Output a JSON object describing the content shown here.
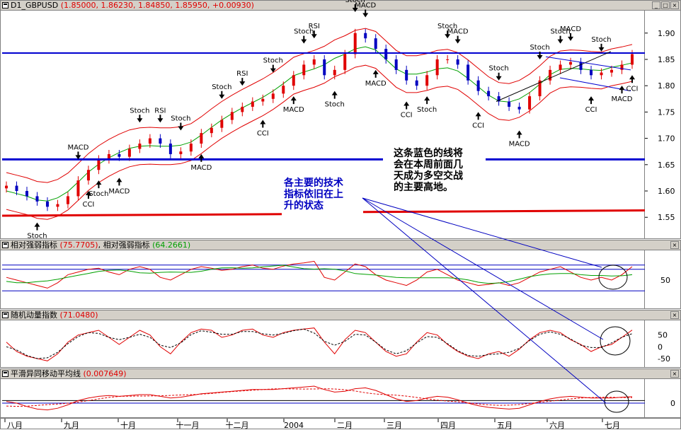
{
  "main": {
    "title_symbol": "D1_GBPUSD",
    "title_values": "(1.85000, 1.86230, 1.84850, 1.85950, +0.00930)",
    "y_ticks": [
      "1.90",
      "1.85",
      "1.80",
      "1.75",
      "1.70",
      "1.65",
      "1.60",
      "1.55"
    ],
    "annotation_right": [
      "这条蓝色的线将",
      "会在本周前面几",
      "天成为多空交战",
      "的主要高地。"
    ],
    "annotation_center": [
      "各主要的技术",
      "指标依旧在上",
      "升的状态"
    ],
    "signal_labels": {
      "stoch": "Stoch",
      "macd": "MACD",
      "cci": "CCI",
      "rsi": "RSI"
    }
  },
  "rsi_panel": {
    "title": "相对强弱指标",
    "value": "(75.7705)",
    "title2": "相对强弱指标",
    "value2": "(64.2661)",
    "y_ticks": [
      "50"
    ]
  },
  "stoch_panel": {
    "title": "随机动量指数",
    "value": "(71.0480)",
    "y_ticks": [
      "50",
      "0",
      "-50"
    ]
  },
  "macd_panel": {
    "title": "平滑异同移动平均线",
    "value": "(0.007649)",
    "y_ticks": [
      "0"
    ]
  },
  "x_axis": [
    "八月",
    "九月",
    "十月",
    "十一月",
    "十二月",
    "2004",
    "二月",
    "三月",
    "四月",
    "五月",
    "六月",
    "七月"
  ],
  "colors": {
    "bull": "#e00000",
    "bear": "#0000c0",
    "band": "#e00000",
    "ma": "#00a000",
    "hline": "#0000d0",
    "support": "#e00000"
  },
  "chart_data": {
    "type": "line",
    "title": "D1_GBPUSD",
    "y_range": [
      1.51,
      1.94
    ],
    "resistance_level": 1.862,
    "support_level": 1.66,
    "ohlc_last": {
      "open": 1.85,
      "high": 1.8623,
      "low": 1.8485,
      "close": 1.8595,
      "change": 0.0093
    },
    "months": [
      "八月",
      "九月",
      "十月",
      "十一月",
      "十二月",
      "2004",
      "二月",
      "三月",
      "四月",
      "五月",
      "六月",
      "七月"
    ],
    "close": [
      1.61,
      1.6,
      1.59,
      1.58,
      1.57,
      1.575,
      1.59,
      1.62,
      1.64,
      1.66,
      1.67,
      1.665,
      1.68,
      1.69,
      1.7,
      1.69,
      1.67,
      1.675,
      1.69,
      1.71,
      1.72,
      1.735,
      1.75,
      1.76,
      1.77,
      1.775,
      1.785,
      1.8,
      1.82,
      1.84,
      1.85,
      1.82,
      1.83,
      1.86,
      1.9,
      1.89,
      1.87,
      1.85,
      1.83,
      1.81,
      1.8,
      1.82,
      1.85,
      1.85,
      1.84,
      1.81,
      1.79,
      1.78,
      1.77,
      1.76,
      1.755,
      1.78,
      1.81,
      1.83,
      1.84,
      1.845,
      1.83,
      1.82,
      1.825,
      1.83,
      1.84,
      1.86
    ],
    "rsi": [
      55,
      50,
      45,
      40,
      35,
      45,
      60,
      65,
      70,
      72,
      65,
      60,
      70,
      75,
      70,
      55,
      50,
      60,
      70,
      75,
      72,
      68,
      70,
      75,
      78,
      72,
      70,
      76,
      80,
      82,
      85,
      55,
      50,
      65,
      80,
      75,
      60,
      50,
      45,
      40,
      50,
      65,
      70,
      60,
      50,
      45,
      40,
      42,
      45,
      40,
      45,
      55,
      65,
      70,
      75,
      65,
      55,
      50,
      55,
      50,
      60,
      75
    ],
    "stoch": [
      20,
      -20,
      -40,
      -50,
      -60,
      -30,
      20,
      50,
      60,
      70,
      40,
      10,
      40,
      70,
      50,
      0,
      -30,
      20,
      60,
      75,
      70,
      40,
      50,
      70,
      75,
      50,
      40,
      60,
      70,
      75,
      80,
      20,
      -30,
      30,
      70,
      60,
      20,
      -20,
      -40,
      -30,
      20,
      60,
      50,
      10,
      -20,
      -40,
      -50,
      -30,
      -20,
      -40,
      -10,
      30,
      60,
      70,
      60,
      30,
      10,
      -20,
      0,
      10,
      40,
      71
    ],
    "macd": [
      0.002,
      0.0,
      -0.004,
      -0.007,
      -0.008,
      -0.006,
      -0.002,
      0.003,
      0.006,
      0.008,
      0.009,
      0.008,
      0.009,
      0.01,
      0.01,
      0.008,
      0.006,
      0.007,
      0.009,
      0.011,
      0.012,
      0.013,
      0.014,
      0.015,
      0.016,
      0.016,
      0.016,
      0.017,
      0.018,
      0.019,
      0.02,
      0.016,
      0.013,
      0.014,
      0.017,
      0.018,
      0.015,
      0.01,
      0.005,
      0.002,
      0.003,
      0.006,
      0.008,
      0.007,
      0.004,
      0.0,
      -0.003,
      -0.005,
      -0.006,
      -0.007,
      -0.006,
      -0.002,
      0.002,
      0.005,
      0.007,
      0.008,
      0.007,
      0.006,
      0.006,
      0.006,
      0.007,
      0.0076
    ]
  }
}
